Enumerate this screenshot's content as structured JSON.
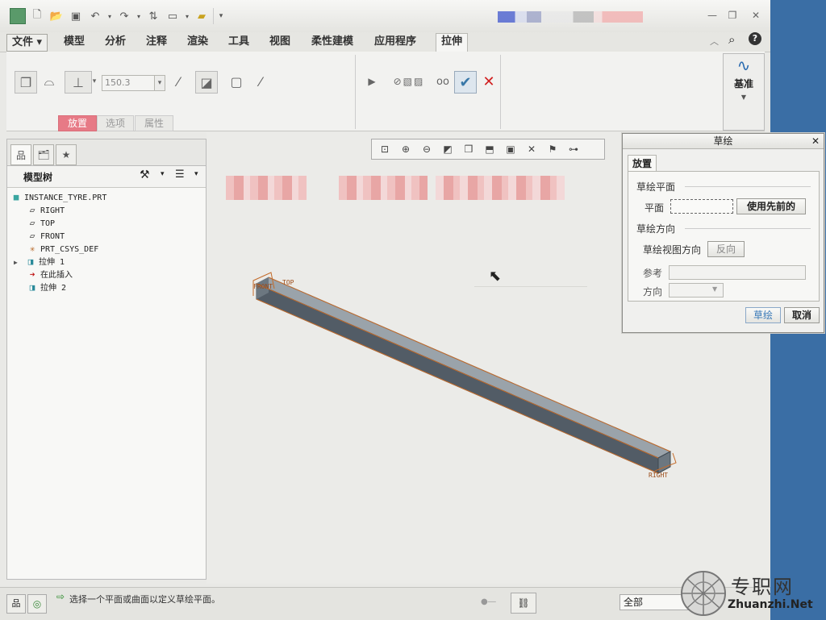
{
  "menu": {
    "tabs": [
      "文件 ▾",
      "模型",
      "分析",
      "注释",
      "渲染",
      "工具",
      "视图",
      "柔性建模",
      "应用程序",
      "拉伸"
    ],
    "active": "拉伸"
  },
  "ribbon": {
    "depth_value": "150.3",
    "subtabs": [
      "放置",
      "选项",
      "属性"
    ],
    "datum_label": "基准"
  },
  "model_tree": {
    "title": "模型树",
    "items": [
      {
        "label": "INSTANCE_TYRE.PRT",
        "icon": "part-icon"
      },
      {
        "label": "RIGHT",
        "icon": "datum-plane-icon"
      },
      {
        "label": "TOP",
        "icon": "datum-plane-icon"
      },
      {
        "label": "FRONT",
        "icon": "datum-plane-icon"
      },
      {
        "label": "PRT_CSYS_DEF",
        "icon": "csys-icon"
      },
      {
        "label": "拉伸 1",
        "icon": "extrude-icon"
      },
      {
        "label": "在此插入",
        "icon": "insert-arrow-icon"
      },
      {
        "label": "拉伸 2",
        "icon": "extrude-new-icon"
      }
    ]
  },
  "viewport": {
    "labels": {
      "front": "FRONT",
      "top": "TOP",
      "right": "RIGHT"
    }
  },
  "dialog": {
    "title": "草绘",
    "tab": "放置",
    "section_plane": "草绘平面",
    "plane_label": "平面",
    "use_prev": "使用先前的",
    "section_orient": "草绘方向",
    "view_dir_label": "草绘视图方向",
    "flip": "反向",
    "ref_label": "参考",
    "dir_label": "方向",
    "ok": "草绘",
    "cancel": "取消"
  },
  "status": {
    "message": "选择一个平面或曲面以定义草绘平面。",
    "filter": "全部"
  },
  "watermark": {
    "cn": "专职网",
    "url": "Zhuanzhi.Net"
  }
}
